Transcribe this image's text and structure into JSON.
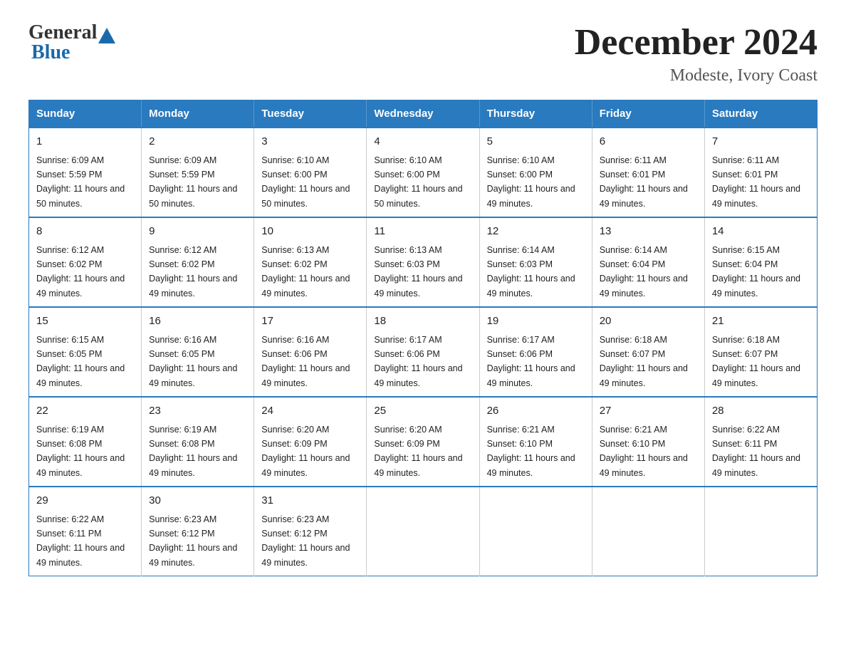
{
  "logo": {
    "part1": "General",
    "part2": "Blue"
  },
  "title": "December 2024",
  "subtitle": "Modeste, Ivory Coast",
  "days_header": [
    "Sunday",
    "Monday",
    "Tuesday",
    "Wednesday",
    "Thursday",
    "Friday",
    "Saturday"
  ],
  "weeks": [
    [
      {
        "day": "1",
        "sunrise": "6:09 AM",
        "sunset": "5:59 PM",
        "daylight": "11 hours and 50 minutes."
      },
      {
        "day": "2",
        "sunrise": "6:09 AM",
        "sunset": "5:59 PM",
        "daylight": "11 hours and 50 minutes."
      },
      {
        "day": "3",
        "sunrise": "6:10 AM",
        "sunset": "6:00 PM",
        "daylight": "11 hours and 50 minutes."
      },
      {
        "day": "4",
        "sunrise": "6:10 AM",
        "sunset": "6:00 PM",
        "daylight": "11 hours and 50 minutes."
      },
      {
        "day": "5",
        "sunrise": "6:10 AM",
        "sunset": "6:00 PM",
        "daylight": "11 hours and 49 minutes."
      },
      {
        "day": "6",
        "sunrise": "6:11 AM",
        "sunset": "6:01 PM",
        "daylight": "11 hours and 49 minutes."
      },
      {
        "day": "7",
        "sunrise": "6:11 AM",
        "sunset": "6:01 PM",
        "daylight": "11 hours and 49 minutes."
      }
    ],
    [
      {
        "day": "8",
        "sunrise": "6:12 AM",
        "sunset": "6:02 PM",
        "daylight": "11 hours and 49 minutes."
      },
      {
        "day": "9",
        "sunrise": "6:12 AM",
        "sunset": "6:02 PM",
        "daylight": "11 hours and 49 minutes."
      },
      {
        "day": "10",
        "sunrise": "6:13 AM",
        "sunset": "6:02 PM",
        "daylight": "11 hours and 49 minutes."
      },
      {
        "day": "11",
        "sunrise": "6:13 AM",
        "sunset": "6:03 PM",
        "daylight": "11 hours and 49 minutes."
      },
      {
        "day": "12",
        "sunrise": "6:14 AM",
        "sunset": "6:03 PM",
        "daylight": "11 hours and 49 minutes."
      },
      {
        "day": "13",
        "sunrise": "6:14 AM",
        "sunset": "6:04 PM",
        "daylight": "11 hours and 49 minutes."
      },
      {
        "day": "14",
        "sunrise": "6:15 AM",
        "sunset": "6:04 PM",
        "daylight": "11 hours and 49 minutes."
      }
    ],
    [
      {
        "day": "15",
        "sunrise": "6:15 AM",
        "sunset": "6:05 PM",
        "daylight": "11 hours and 49 minutes."
      },
      {
        "day": "16",
        "sunrise": "6:16 AM",
        "sunset": "6:05 PM",
        "daylight": "11 hours and 49 minutes."
      },
      {
        "day": "17",
        "sunrise": "6:16 AM",
        "sunset": "6:06 PM",
        "daylight": "11 hours and 49 minutes."
      },
      {
        "day": "18",
        "sunrise": "6:17 AM",
        "sunset": "6:06 PM",
        "daylight": "11 hours and 49 minutes."
      },
      {
        "day": "19",
        "sunrise": "6:17 AM",
        "sunset": "6:06 PM",
        "daylight": "11 hours and 49 minutes."
      },
      {
        "day": "20",
        "sunrise": "6:18 AM",
        "sunset": "6:07 PM",
        "daylight": "11 hours and 49 minutes."
      },
      {
        "day": "21",
        "sunrise": "6:18 AM",
        "sunset": "6:07 PM",
        "daylight": "11 hours and 49 minutes."
      }
    ],
    [
      {
        "day": "22",
        "sunrise": "6:19 AM",
        "sunset": "6:08 PM",
        "daylight": "11 hours and 49 minutes."
      },
      {
        "day": "23",
        "sunrise": "6:19 AM",
        "sunset": "6:08 PM",
        "daylight": "11 hours and 49 minutes."
      },
      {
        "day": "24",
        "sunrise": "6:20 AM",
        "sunset": "6:09 PM",
        "daylight": "11 hours and 49 minutes."
      },
      {
        "day": "25",
        "sunrise": "6:20 AM",
        "sunset": "6:09 PM",
        "daylight": "11 hours and 49 minutes."
      },
      {
        "day": "26",
        "sunrise": "6:21 AM",
        "sunset": "6:10 PM",
        "daylight": "11 hours and 49 minutes."
      },
      {
        "day": "27",
        "sunrise": "6:21 AM",
        "sunset": "6:10 PM",
        "daylight": "11 hours and 49 minutes."
      },
      {
        "day": "28",
        "sunrise": "6:22 AM",
        "sunset": "6:11 PM",
        "daylight": "11 hours and 49 minutes."
      }
    ],
    [
      {
        "day": "29",
        "sunrise": "6:22 AM",
        "sunset": "6:11 PM",
        "daylight": "11 hours and 49 minutes."
      },
      {
        "day": "30",
        "sunrise": "6:23 AM",
        "sunset": "6:12 PM",
        "daylight": "11 hours and 49 minutes."
      },
      {
        "day": "31",
        "sunrise": "6:23 AM",
        "sunset": "6:12 PM",
        "daylight": "11 hours and 49 minutes."
      },
      null,
      null,
      null,
      null
    ]
  ]
}
